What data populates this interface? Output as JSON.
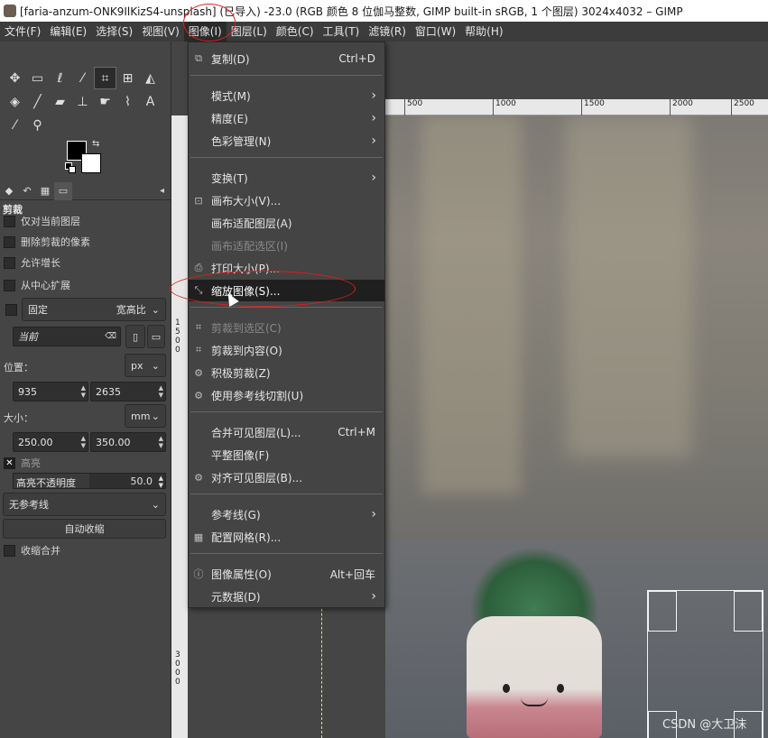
{
  "titlebar": {
    "title": "[faria-anzum-ONK9IlKizS4-unsplash] (已导入) -23.0 (RGB 颜色 8 位伽马整数, GIMP built-in sRGB, 1 个图层) 3024x4032 – GIMP"
  },
  "menubar": {
    "items": [
      {
        "label": "文件(F)"
      },
      {
        "label": "编辑(E)"
      },
      {
        "label": "选择(S)"
      },
      {
        "label": "视图(V)"
      },
      {
        "label": "图像(I)"
      },
      {
        "label": "图层(L)"
      },
      {
        "label": "颜色(C)"
      },
      {
        "label": "工具(T)"
      },
      {
        "label": "滤镜(R)"
      },
      {
        "label": "窗口(W)"
      },
      {
        "label": "帮助(H)"
      }
    ]
  },
  "image_menu": {
    "items": [
      {
        "label": "复制(D)",
        "shortcut": "Ctrl+D",
        "icon": "duplicate-icon"
      },
      {
        "label": "模式(M)",
        "submenu": true
      },
      {
        "label": "精度(E)",
        "submenu": true
      },
      {
        "label": "色彩管理(N)",
        "submenu": true
      },
      {
        "label": "变换(T)",
        "submenu": true
      },
      {
        "label": "画布大小(V)...",
        "icon": "canvas-size-icon"
      },
      {
        "label": "画布适配图层(A)"
      },
      {
        "label": "画布适配选区(I)",
        "disabled": true
      },
      {
        "label": "打印大小(P)...",
        "icon": "printer-icon"
      },
      {
        "label": "缩放图像(S)...",
        "icon": "scale-image-icon",
        "highlighted": true
      },
      {
        "label": "剪裁到选区(C)",
        "disabled": true,
        "icon": "crop-selection-icon"
      },
      {
        "label": "剪裁到内容(O)",
        "icon": "crop-content-icon"
      },
      {
        "label": "积极剪裁(Z)",
        "icon": "zealous-crop-icon"
      },
      {
        "label": "使用参考线切割(U)",
        "icon": "guillotine-icon"
      },
      {
        "label": "合并可见图层(L)...",
        "shortcut": "Ctrl+M"
      },
      {
        "label": "平整图像(F)"
      },
      {
        "label": "对齐可见图层(B)...",
        "icon": "align-icon"
      },
      {
        "label": "参考线(G)",
        "submenu": true
      },
      {
        "label": "配置网格(R)...",
        "icon": "grid-icon"
      },
      {
        "label": "图像属性(O)",
        "shortcut": "Alt+回车",
        "icon": "info-icon"
      },
      {
        "label": "元数据(D)",
        "submenu": true
      }
    ]
  },
  "tool_options": {
    "title": "剪裁",
    "current_layer_only": "仅对当前图层",
    "delete_cropped": "删除剪裁的像素",
    "allow_growing": "允许增长",
    "expand_center": "从中心扩展",
    "fixed_label": "固定",
    "fixed_mode": "宽高比",
    "preset_placeholder": "当前",
    "position_label": "位置：",
    "position_unit": "px",
    "position_x": "935",
    "position_y": "2635",
    "size_label": "大小：",
    "size_unit": "mm",
    "size_w": "250.00",
    "size_h": "350.00",
    "highlight_label": "高亮",
    "highlight_opacity_label": "高亮不透明度",
    "highlight_opacity_value": "50.0",
    "highlight_opacity": 0.5,
    "guides": "无参考线",
    "auto_shrink": "自动收缩",
    "shrink_merged": "收缩合并"
  },
  "ruler": {
    "h_ticks": [
      "500",
      "1000",
      "1500",
      "2000",
      "2500"
    ],
    "v_ticks_1": [
      "1",
      "5",
      "0",
      "0"
    ],
    "v_ticks_2": [
      "3",
      "0",
      "0",
      "0"
    ]
  },
  "watermark": "CSDN @大卫沫",
  "colors": {
    "annotation": "#d82020",
    "menu_highlight": "#1f1f1f"
  }
}
